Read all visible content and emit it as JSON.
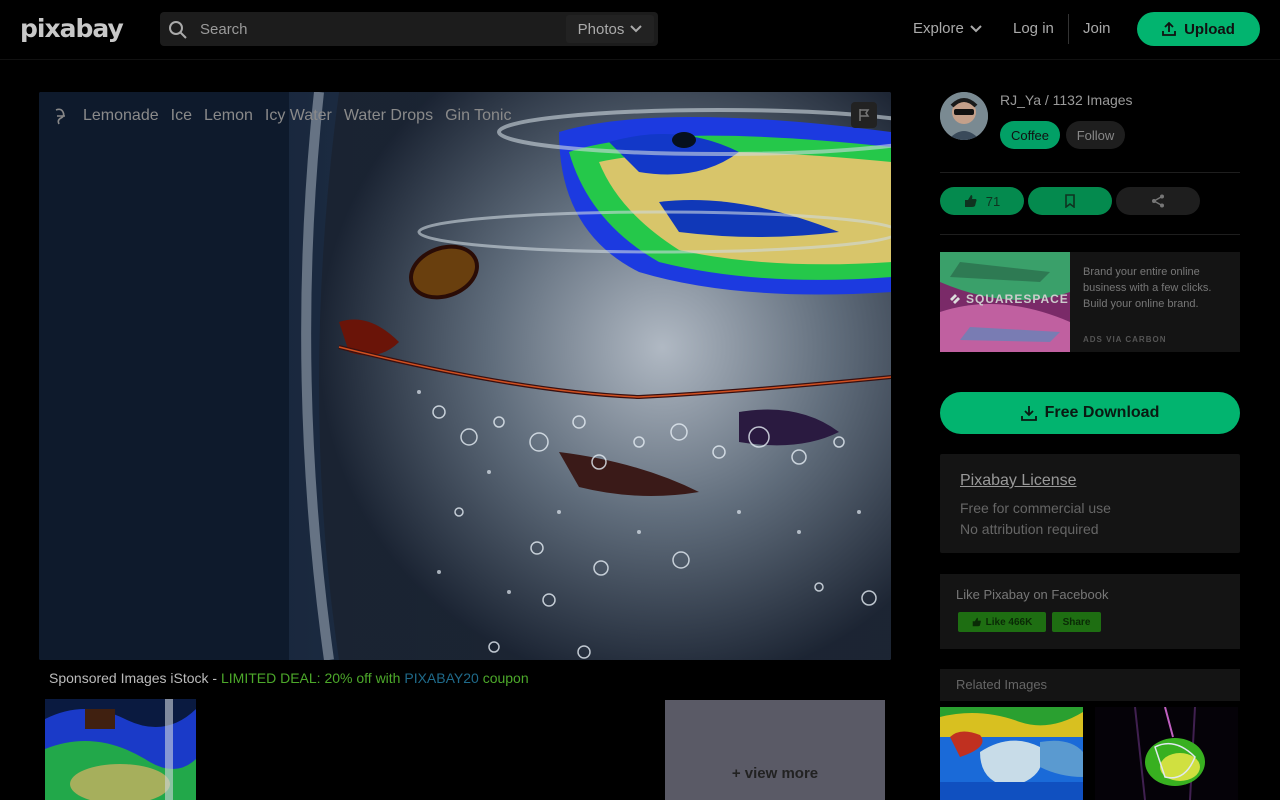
{
  "header": {
    "logo": "pixabay",
    "search_placeholder": "Search",
    "search_type": "Photos",
    "explore": "Explore",
    "login": "Log in",
    "join": "Join",
    "upload": "Upload"
  },
  "image": {
    "tags": [
      "Lemonade",
      "Ice",
      "Lemon",
      "Icy Water",
      "Water Drops",
      "Gin Tonic"
    ]
  },
  "sponsored": {
    "prefix": "Sponsored Images iStock - ",
    "deal": "LIMITED DEAL: 20% off with ",
    "code": "PIXABAY20",
    "suffix": " coupon",
    "view_more": "+ view more"
  },
  "sidebar": {
    "author": "RJ_Ya / 1132 Images",
    "coffee": "Coffee",
    "follow": "Follow",
    "likes": "71",
    "ad": {
      "brand": "SQUARESPACE",
      "text": "Brand your entire online business with a few clicks. Build your online brand.",
      "via": "ADS VIA CARBON"
    },
    "download": "Free Download",
    "license": {
      "title": "Pixabay License",
      "line1": "Free for commercial use",
      "line2": "No attribution required"
    },
    "facebook": {
      "title": "Like Pixabay on Facebook",
      "like": "Like 466K",
      "share": "Share"
    },
    "related_title": "Related Images"
  },
  "colors": {
    "accent": "#02b46f",
    "background": "#000000"
  }
}
